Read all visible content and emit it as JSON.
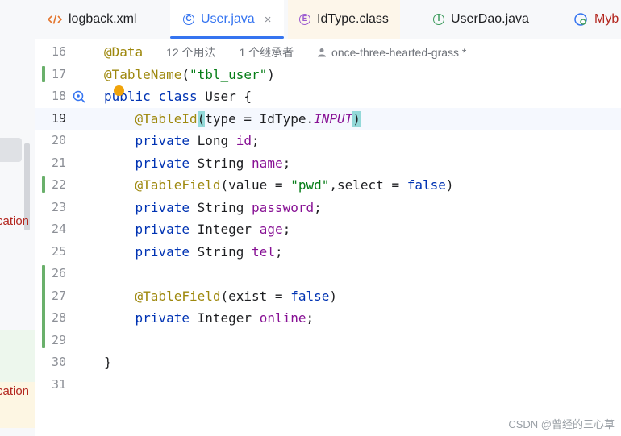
{
  "tabs": [
    {
      "label": "logback.xml",
      "icon": "xml-icon"
    },
    {
      "label": "User.java",
      "icon": "class-icon",
      "close": "×"
    },
    {
      "label": "IdType.class",
      "icon": "enum-icon"
    },
    {
      "label": "UserDao.java",
      "icon": "interface-icon"
    },
    {
      "label": "Myb",
      "icon": "config-icon"
    }
  ],
  "left_panel": {
    "frag1": "cation",
    "frag2": "cation"
  },
  "inlay": {
    "usages": "12 个用法",
    "inheritors": "1 个继承者",
    "author": "once-three-hearted-grass *"
  },
  "lines": [
    "16",
    "17",
    "18",
    "19",
    "20",
    "21",
    "22",
    "23",
    "24",
    "25",
    "26",
    "27",
    "28",
    "29",
    "30",
    "31"
  ],
  "code": {
    "l16": "@Data",
    "l17_ann": "@TableName",
    "l17_open": "(",
    "l17_str": "\"tbl_user\"",
    "l17_close": ")",
    "l18_kw1": "public",
    "l18_kw2": "class",
    "l18_name": "User {",
    "l19_ann": "@TableId",
    "l19_open": "(",
    "l19_mid": "type = IdType.",
    "l19_const": "INPUT",
    "l19_close": ")",
    "l20_kw": "private",
    "l20_type": "Long",
    "l20_fld": "id",
    "l21_kw": "private",
    "l21_type": "String",
    "l21_fld": "name",
    "l22_ann": "@TableField",
    "l22_a": "(value = ",
    "l22_str": "\"pwd\"",
    "l22_b": ",select = ",
    "l22_kw": "false",
    "l22_c": ")",
    "l23_kw": "private",
    "l23_type": "String",
    "l23_fld": "password",
    "l24_kw": "private",
    "l24_type": "Integer",
    "l24_fld": "age",
    "l25_kw": "private",
    "l25_type": "String",
    "l25_fld": "tel",
    "l27_ann": "@TableField",
    "l27_a": "(exist = ",
    "l27_kw": "false",
    "l27_c": ")",
    "l28_kw": "private",
    "l28_type": "Integer",
    "l28_fld": "online",
    "l30": "}",
    "semi": ";"
  },
  "watermark": "CSDN @曾经的三心草",
  "colors": {
    "accent": "#3574f0",
    "keyword": "#0033b3",
    "annotation": "#9e880d",
    "string": "#067d17",
    "field": "#871094",
    "vcs_added": "#6ab06b"
  }
}
